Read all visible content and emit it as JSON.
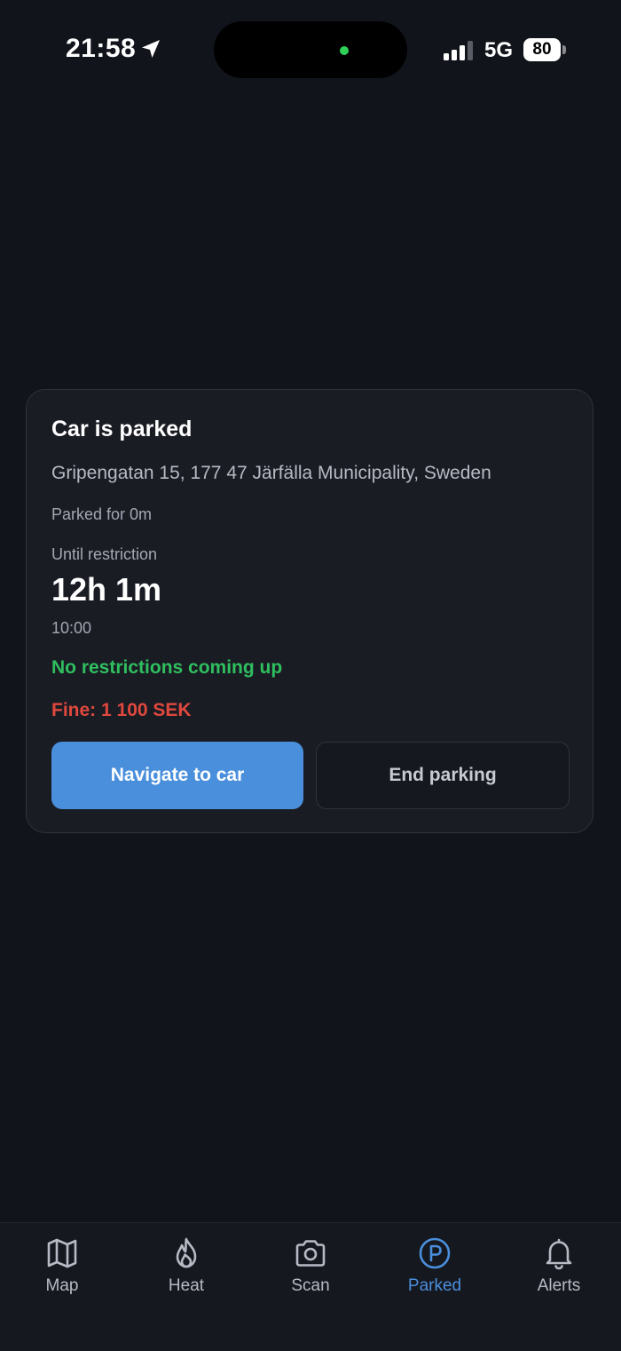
{
  "status_bar": {
    "time": "21:58",
    "network": "5G",
    "battery": "80"
  },
  "card": {
    "title": "Car is parked",
    "address": "Gripengatan 15, 177 47 Järfälla Municipality, Sweden",
    "parked_for": "Parked for 0m",
    "until_label": "Until restriction",
    "countdown": "12h 1m",
    "restriction_time": "10:00",
    "restriction_status": "No restrictions coming up",
    "fine": "Fine: 1 100 SEK",
    "navigate_label": "Navigate to car",
    "end_label": "End parking"
  },
  "tabs": [
    {
      "label": "Map",
      "icon": "map-icon",
      "active": false
    },
    {
      "label": "Heat",
      "icon": "flame-icon",
      "active": false
    },
    {
      "label": "Scan",
      "icon": "camera-icon",
      "active": false
    },
    {
      "label": "Parked",
      "icon": "parking-icon",
      "active": true
    },
    {
      "label": "Alerts",
      "icon": "bell-icon",
      "active": false
    }
  ],
  "colors": {
    "background": "#12141c",
    "card": "#1a1c24",
    "accent": "#4a8fdc",
    "success": "#2fbf5f",
    "danger": "#e0483e",
    "muted_text": "#a3a7b2"
  }
}
